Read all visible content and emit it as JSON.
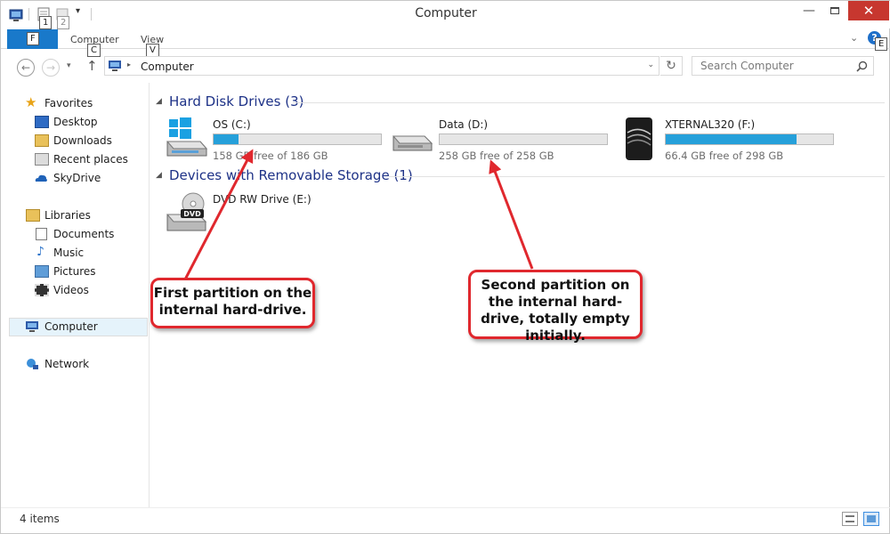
{
  "window": {
    "title": "Computer",
    "quick_access_keytips": [
      "1",
      "2"
    ]
  },
  "ribbon": {
    "file_keytip": "F",
    "tabs": [
      {
        "label": "Computer",
        "keytip": "C"
      },
      {
        "label": "View",
        "keytip": "V"
      }
    ],
    "help_keytip": "E"
  },
  "address": {
    "path": "Computer",
    "search_placeholder": "Search Computer"
  },
  "nav": {
    "favorites_label": "Favorites",
    "favorites": [
      "Desktop",
      "Downloads",
      "Recent places",
      "SkyDrive"
    ],
    "libraries_label": "Libraries",
    "libraries": [
      "Documents",
      "Music",
      "Pictures",
      "Videos"
    ],
    "computer_label": "Computer",
    "network_label": "Network"
  },
  "groups": {
    "hard_disk": {
      "title": "Hard Disk Drives (3)",
      "drives": [
        {
          "name": "OS (C:)",
          "free_text": "158 GB free of 186 GB",
          "used_fraction": 0.15
        },
        {
          "name": "Data (D:)",
          "free_text": "258 GB free of 258 GB",
          "used_fraction": 0.0
        },
        {
          "name": "XTERNAL320 (F:)",
          "free_text": "66.4 GB free of 298 GB",
          "used_fraction": 0.78
        }
      ]
    },
    "removable": {
      "title": "Devices with Removable Storage (1)",
      "drives": [
        {
          "name": "DVD RW Drive (E:)",
          "icon_label": "DVD"
        }
      ]
    }
  },
  "status": {
    "items_text": "4 items"
  },
  "callouts": [
    {
      "text": "First partition on the internal hard-drive."
    },
    {
      "text": "Second partition on the internal hard-drive, totally empty initially."
    }
  ],
  "colors": {
    "accent": "#1979ca",
    "bar_fill": "#26a0da",
    "callout_border": "#e0282e",
    "group_title": "#1e3287",
    "close_button": "#c7372f"
  }
}
